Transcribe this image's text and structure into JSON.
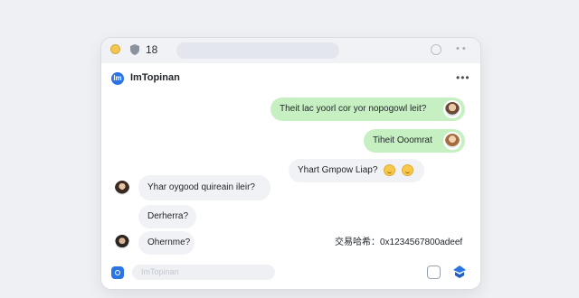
{
  "topbar": {
    "count": "18",
    "more": "• •"
  },
  "header": {
    "logo_text": "Im",
    "title": "ImTopinan",
    "more": "•••"
  },
  "messages": [
    {
      "dir": "out",
      "text": "Theit lac yoorl cor yor nopogowl leit?"
    },
    {
      "dir": "out",
      "text": "Tiheit Ooomrat"
    },
    {
      "dir": "in",
      "text": "Yhart Gmpow Liap?"
    },
    {
      "dir": "in",
      "text": "Yhar oygood quireain ileir?"
    },
    {
      "dir": "in",
      "text": "Derherra?"
    },
    {
      "dir": "in",
      "text": "Ohernme?"
    }
  ],
  "transaction": "交易哈希：0x1234567800adeef",
  "input": {
    "placeholder": "ImTopinan"
  },
  "colors": {
    "accent": "#2b74e6",
    "outgoing_bubble": "#c7f0c2",
    "incoming_bubble": "#f0f2f5"
  }
}
